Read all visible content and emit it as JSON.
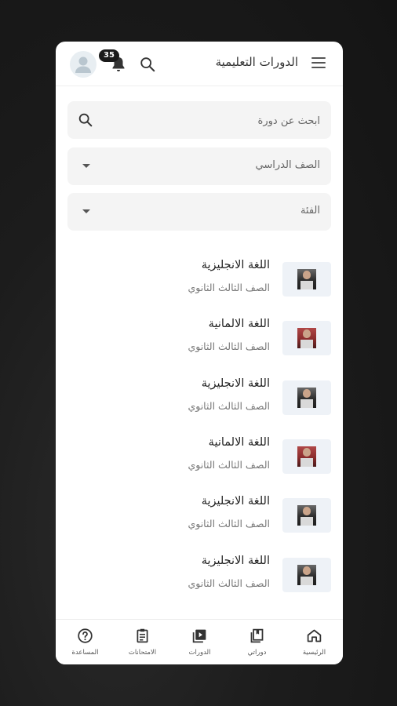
{
  "header": {
    "title": "الدورات التعليمية",
    "notification_count": "35",
    "menu_icon": "menu-icon",
    "search_icon": "search-icon",
    "bell_icon": "bell-icon",
    "avatar_icon": "user-avatar-icon"
  },
  "search": {
    "placeholder": "ابحث عن دورة"
  },
  "filters": {
    "grade": {
      "selected": "الصف الدراسي"
    },
    "category": {
      "selected": "الفئة"
    }
  },
  "courses": [
    {
      "title": "اللغة الانجليزية",
      "grade": "الصف الثالث الثانوي"
    },
    {
      "title": "اللغة الالمانية",
      "grade": "الصف الثالث الثانوي"
    },
    {
      "title": "اللغة الانجليزية",
      "grade": "الصف الثالث الثانوي"
    },
    {
      "title": "اللغة الالمانية",
      "grade": "الصف الثالث الثانوي"
    },
    {
      "title": "اللغة الانجليزية",
      "grade": "الصف الثالث الثانوي"
    },
    {
      "title": "اللغة الانجليزية",
      "grade": "الصف الثالث الثانوي"
    }
  ],
  "bottom_nav": [
    {
      "label": "الرئيسية",
      "icon": "home-icon"
    },
    {
      "label": "دوراتي",
      "icon": "my-courses-icon"
    },
    {
      "label": "الدورات",
      "icon": "courses-play-icon"
    },
    {
      "label": "الامتحانات",
      "icon": "exams-clipboard-icon"
    },
    {
      "label": "المساعدة",
      "icon": "help-icon"
    }
  ],
  "colors": {
    "background": "#1c1c1c",
    "surface": "#ffffff",
    "field_bg": "#f4f4f4",
    "thumb_bg": "#eef2f7",
    "badge": "#1a1a1a"
  }
}
